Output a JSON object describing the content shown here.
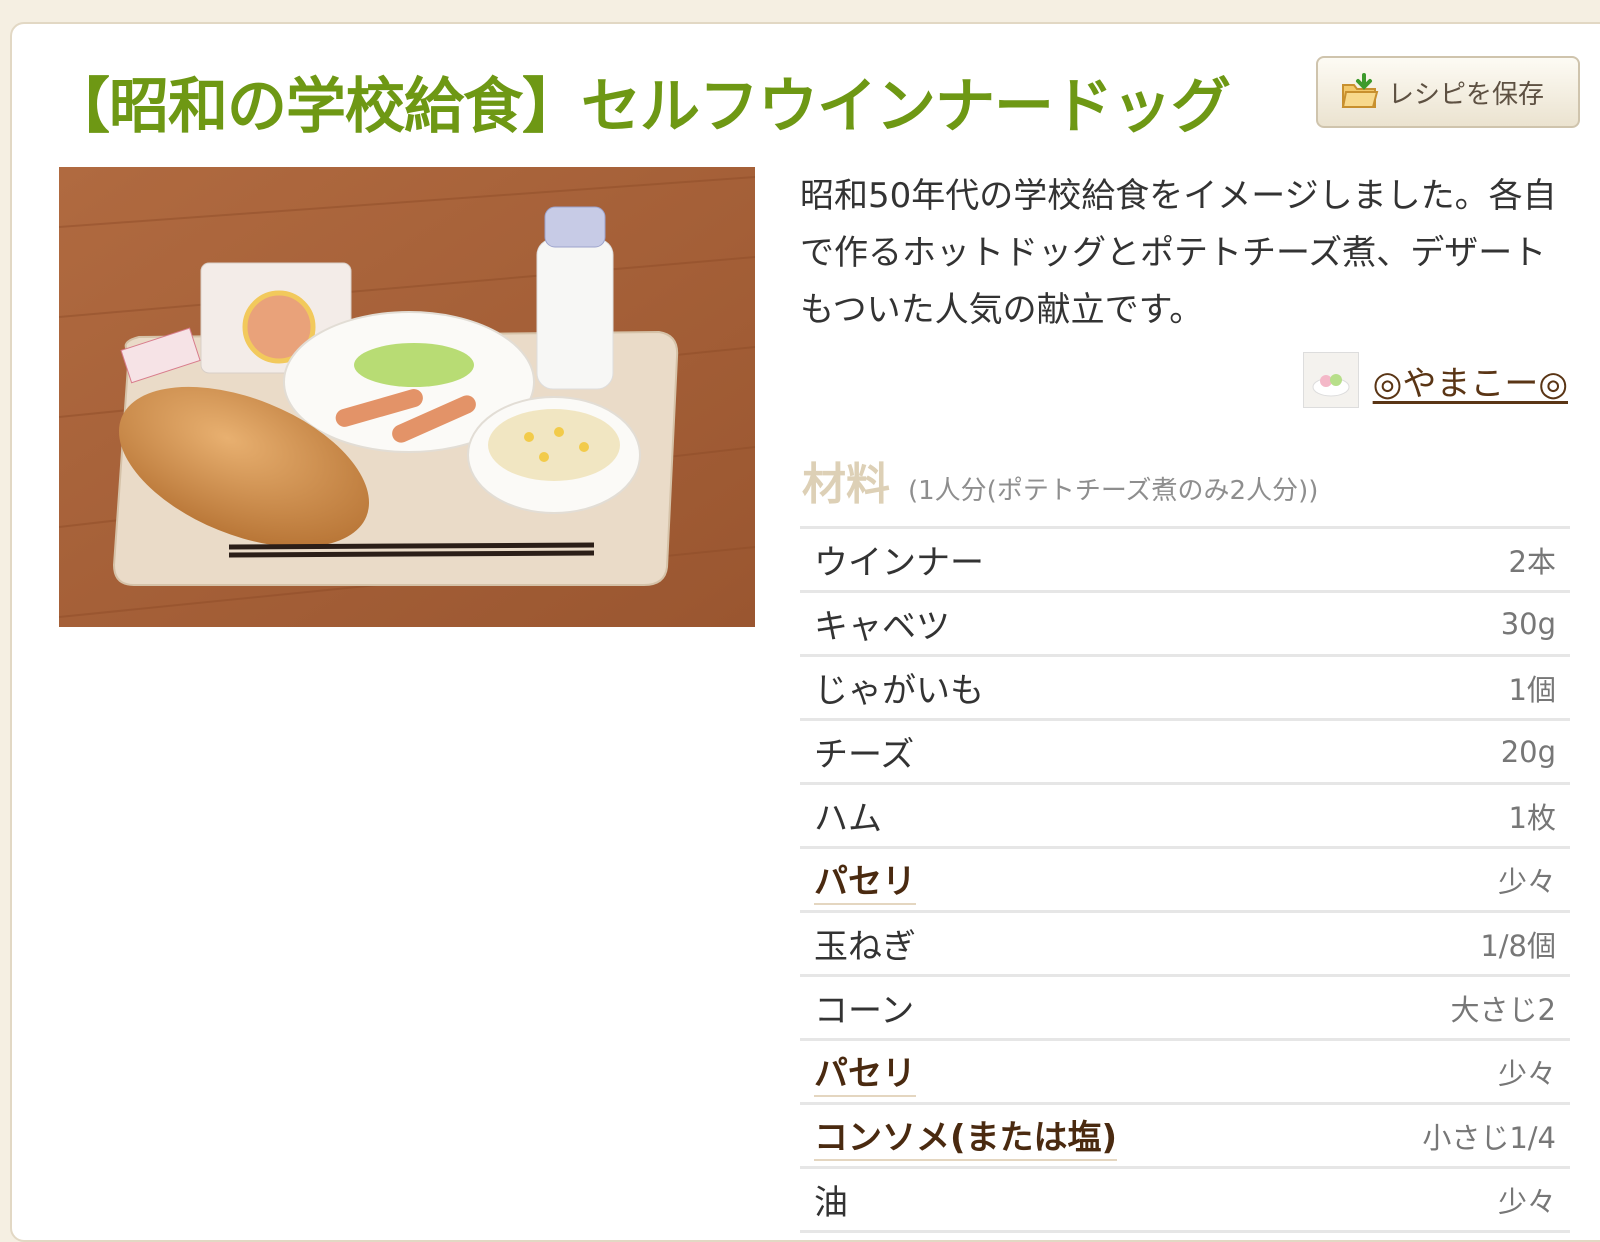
{
  "recipe": {
    "title": "【昭和の学校給食】セルフウインナードッグ",
    "save_label": "レシピを保存",
    "description": "昭和50年代の学校給食をイメージしました。各自で作るホットドッグとポテトチーズ煮、デザートもついた人気の献立です。",
    "author": "◎やまこー◎"
  },
  "ingredients": {
    "title": "材料",
    "servings": "(1人分(ポテトチーズ煮のみ2人分))",
    "items": [
      {
        "name": "ウインナー",
        "amount": "2本",
        "link": false
      },
      {
        "name": "キャベツ",
        "amount": "30g",
        "link": false
      },
      {
        "name": "じゃがいも",
        "amount": "1個",
        "link": false
      },
      {
        "name": "チーズ",
        "amount": "20g",
        "link": false
      },
      {
        "name": "ハム",
        "amount": "1枚",
        "link": false
      },
      {
        "name": "パセリ",
        "amount": "少々",
        "link": true
      },
      {
        "name": "玉ねぎ",
        "amount": "1/8個",
        "link": false
      },
      {
        "name": "コーン",
        "amount": "大さじ2",
        "link": false
      },
      {
        "name": "パセリ",
        "amount": "少々",
        "link": true
      },
      {
        "name": "コンソメ(または塩)",
        "amount": "小さじ1/4",
        "link": true
      },
      {
        "name": "油",
        "amount": "少々",
        "link": false
      }
    ]
  },
  "colors": {
    "title": "#6e9814",
    "page_background": "#f5efe2",
    "link": "#4a2a10"
  }
}
